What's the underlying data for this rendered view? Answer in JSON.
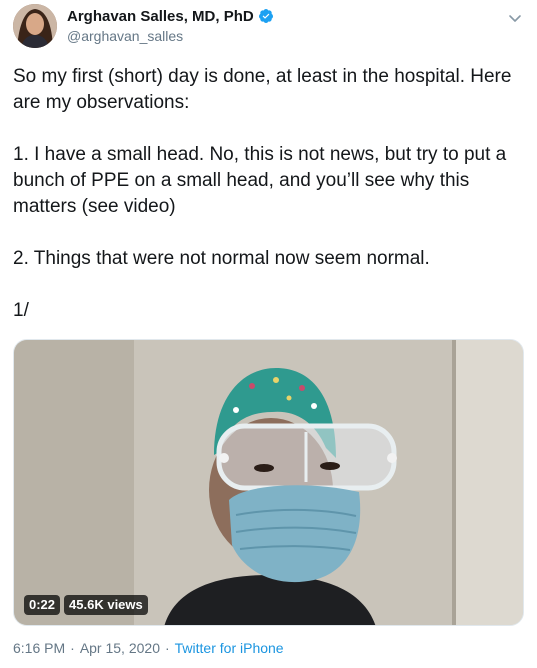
{
  "author": {
    "display_name": "Arghavan Salles, MD, PhD",
    "handle": "@arghavan_salles",
    "verified": true
  },
  "tweet": {
    "paragraphs": [
      "So my first (short) day is done, at least in the hospital. Here are my observations:",
      "1. I have a small head. No, this is not news, but try to put a bunch of PPE on a small head, and you’ll see why this matters (see video)",
      "2. Things that were not normal now seem normal.",
      "1/"
    ]
  },
  "video": {
    "duration": "0:22",
    "views": "45.6K views"
  },
  "footer": {
    "time": "6:16 PM",
    "date": "Apr 15, 2020",
    "source": "Twitter for iPhone",
    "separator": "·"
  },
  "colors": {
    "verified_blue": "#1da1f2",
    "link_blue": "#1b95e0",
    "secondary_text": "#657786"
  },
  "icons": {
    "verified": "verified-badge-icon",
    "caret": "chevron-down-icon"
  }
}
